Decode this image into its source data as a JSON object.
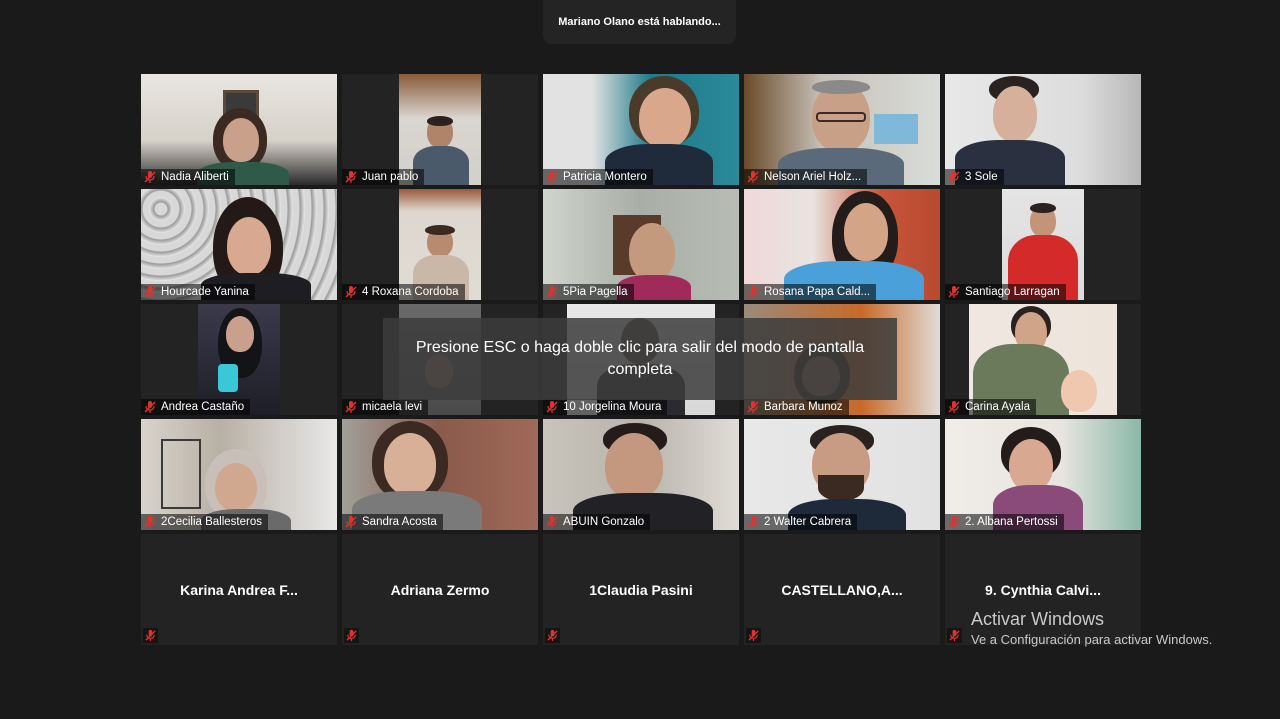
{
  "speaker_banner": "Mariano Olano está hablando...",
  "overlay_message": "Presione ESC o haga doble clic para salir del modo de pantalla completa",
  "windows_notice": {
    "title": "Activar Windows",
    "subtitle": "Ve a Configuración para activar Windows."
  },
  "icons": {
    "muted_mic": "mic-muted-icon"
  },
  "colors": {
    "mic_muted": "#e0322f",
    "background": "#1a1a1a",
    "tile": "#232323"
  },
  "participants": [
    {
      "name": "Nadia Aliberti"
    },
    {
      "name": "Juan pablo"
    },
    {
      "name": "Patricia Montero"
    },
    {
      "name": "Nelson Ariel Holz..."
    },
    {
      "name": "3 Sole"
    },
    {
      "name": "Hourcade Yanina"
    },
    {
      "name": "4 Roxana Cordoba"
    },
    {
      "name": "5Pia Pagella"
    },
    {
      "name": "Rosana Papa Cald..."
    },
    {
      "name": "Santiago Larragan"
    },
    {
      "name": "Andrea Castaño"
    },
    {
      "name": "micaela levi"
    },
    {
      "name": "10 Jorgelina Moura"
    },
    {
      "name": "Barbara Munoz"
    },
    {
      "name": "Carina Ayala"
    },
    {
      "name": "2Cecilia Ballesteros"
    },
    {
      "name": "Sandra Acosta"
    },
    {
      "name": "ABUIN Gonzalo"
    },
    {
      "name": "2 Walter Cabrera"
    },
    {
      "name": "2. Albana Pertossi"
    },
    {
      "name": "Karina Andrea F..."
    },
    {
      "name": "Adriana Zermo"
    },
    {
      "name": "1Claudia Pasini"
    },
    {
      "name": "CASTELLANO,A..."
    },
    {
      "name": "9.  Cynthia Calvi..."
    }
  ]
}
